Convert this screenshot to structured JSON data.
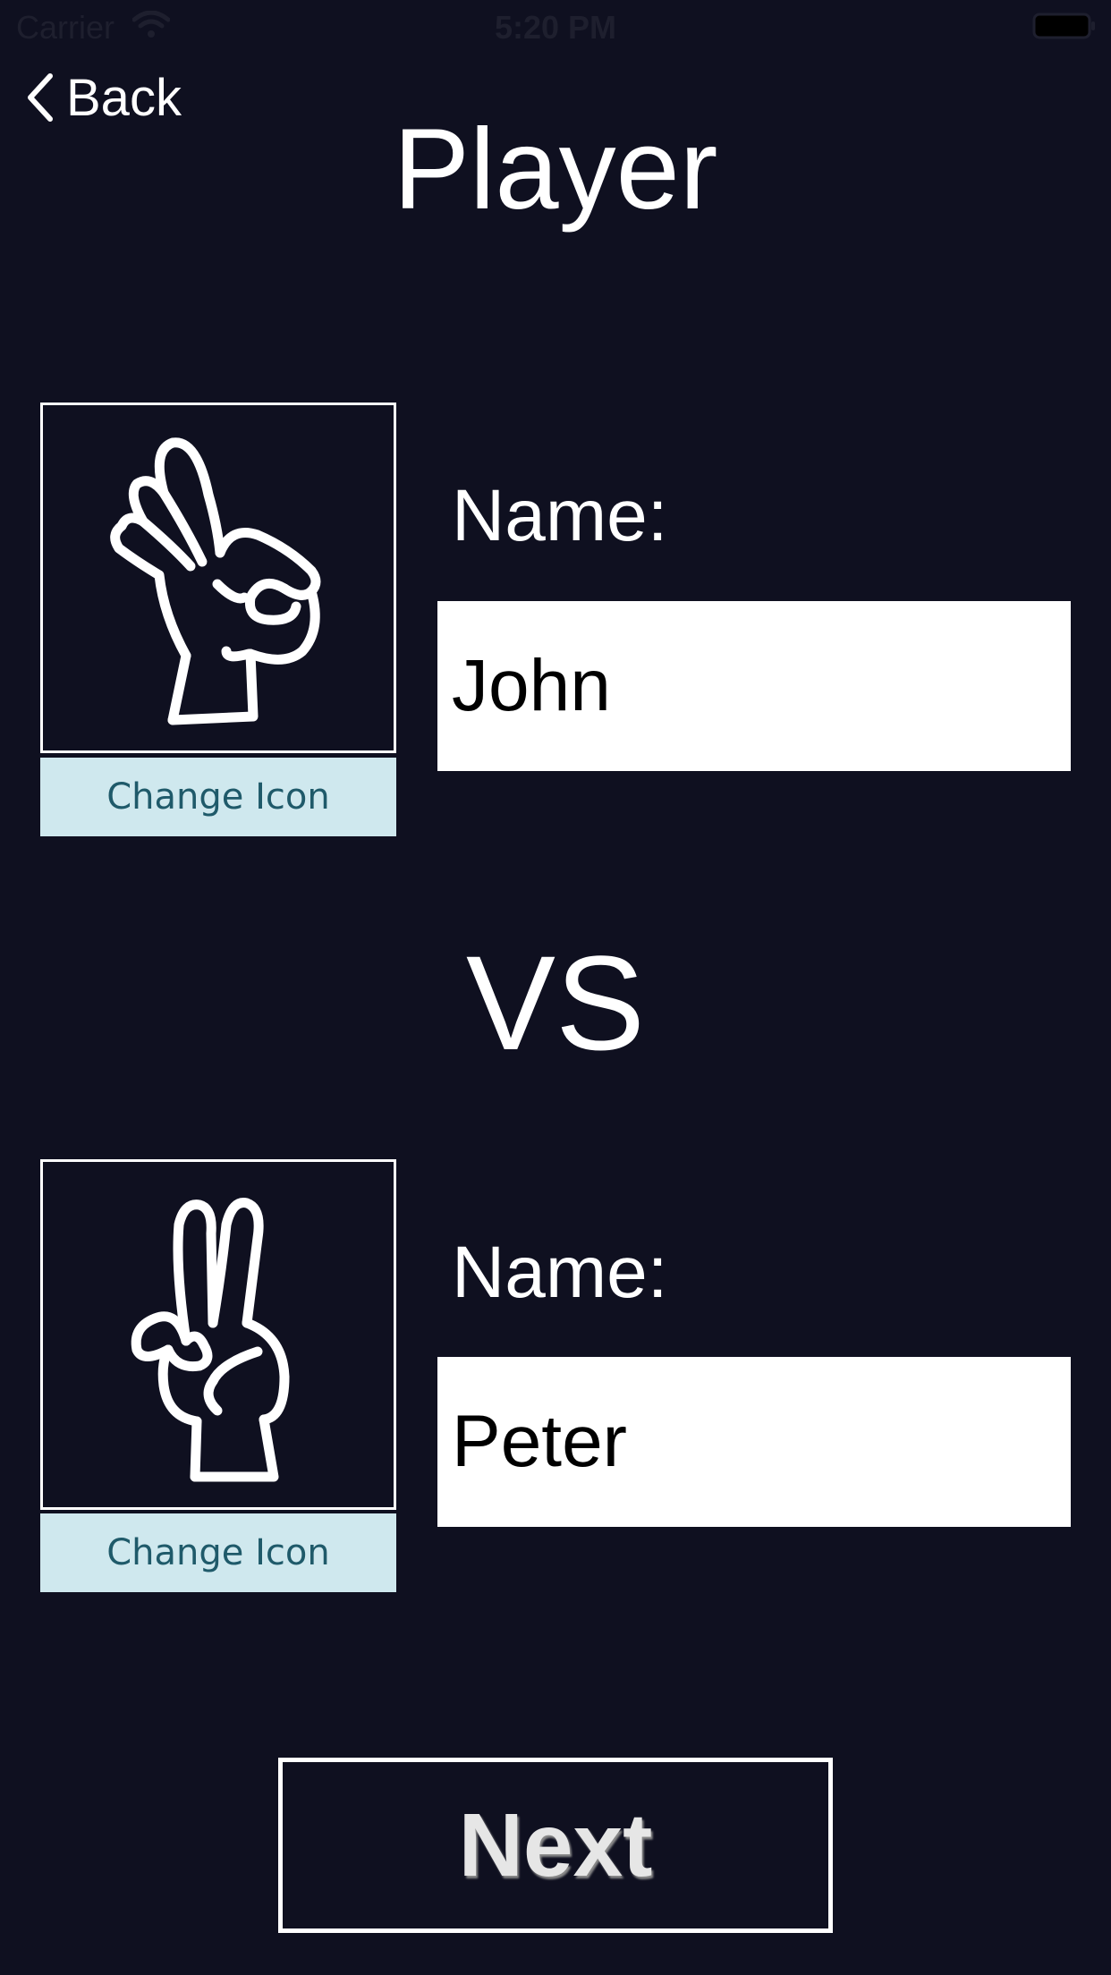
{
  "status_bar": {
    "carrier": "Carrier",
    "time": "5:20 PM",
    "icons": [
      "wifi-icon",
      "battery-icon"
    ]
  },
  "nav": {
    "back_label": "Back",
    "back_icon": "chevron-left-icon"
  },
  "title": "Player",
  "player1": {
    "icon": "ok-hand-icon",
    "change_icon_label": "Change Icon",
    "name_label": "Name:",
    "name_value": "John"
  },
  "vs_label": "VS",
  "player2": {
    "icon": "peace-hand-icon",
    "change_icon_label": "Change Icon",
    "name_label": "Name:",
    "name_value": "Peter"
  },
  "next_label": "Next",
  "colors": {
    "background": "#0f1020",
    "change_icon_bg": "#cfe8ee",
    "change_icon_text": "#1f5a6a",
    "input_bg": "#ffffff"
  }
}
